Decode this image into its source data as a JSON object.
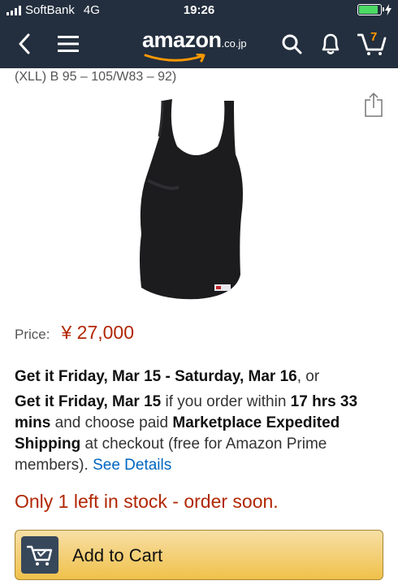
{
  "status_bar": {
    "carrier": "SoftBank",
    "network": "4G",
    "time": "19:26",
    "battery_level": 0.9
  },
  "nav": {
    "logo_word": "amazon",
    "logo_tld": ".co.jp",
    "cart_count": "7",
    "icons": [
      "back-chevron-icon",
      "menu-icon",
      "search-icon",
      "bell-icon",
      "cart-icon"
    ]
  },
  "product": {
    "size_text": "(XLL) B 95 – 105/W83 – 92)",
    "price_label": "Price:",
    "price": "¥ 27,000"
  },
  "delivery": {
    "line1_bold": "Get it Friday, Mar 15 - Saturday, Mar 16",
    "line1_tail": ", or",
    "line2_bold1": "Get it Friday, Mar 15",
    "line2_text1": " if you order within ",
    "line2_bold2": "17 hrs 33 mins",
    "line2_text2": " and choose paid ",
    "line2_bold3": "Marketplace Expedited Shipping",
    "line2_text3": " at checkout (free for Amazon Prime members). ",
    "see_details": "See Details"
  },
  "stock_message": "Only 1 left in stock - order soon.",
  "add_to_cart": "Add to Cart",
  "colors": {
    "nav_bg": "#232f3e",
    "price": "#b12704",
    "link": "#0066c0",
    "cart_button": "#f0c14b",
    "amazon_orange": "#ff9900"
  }
}
